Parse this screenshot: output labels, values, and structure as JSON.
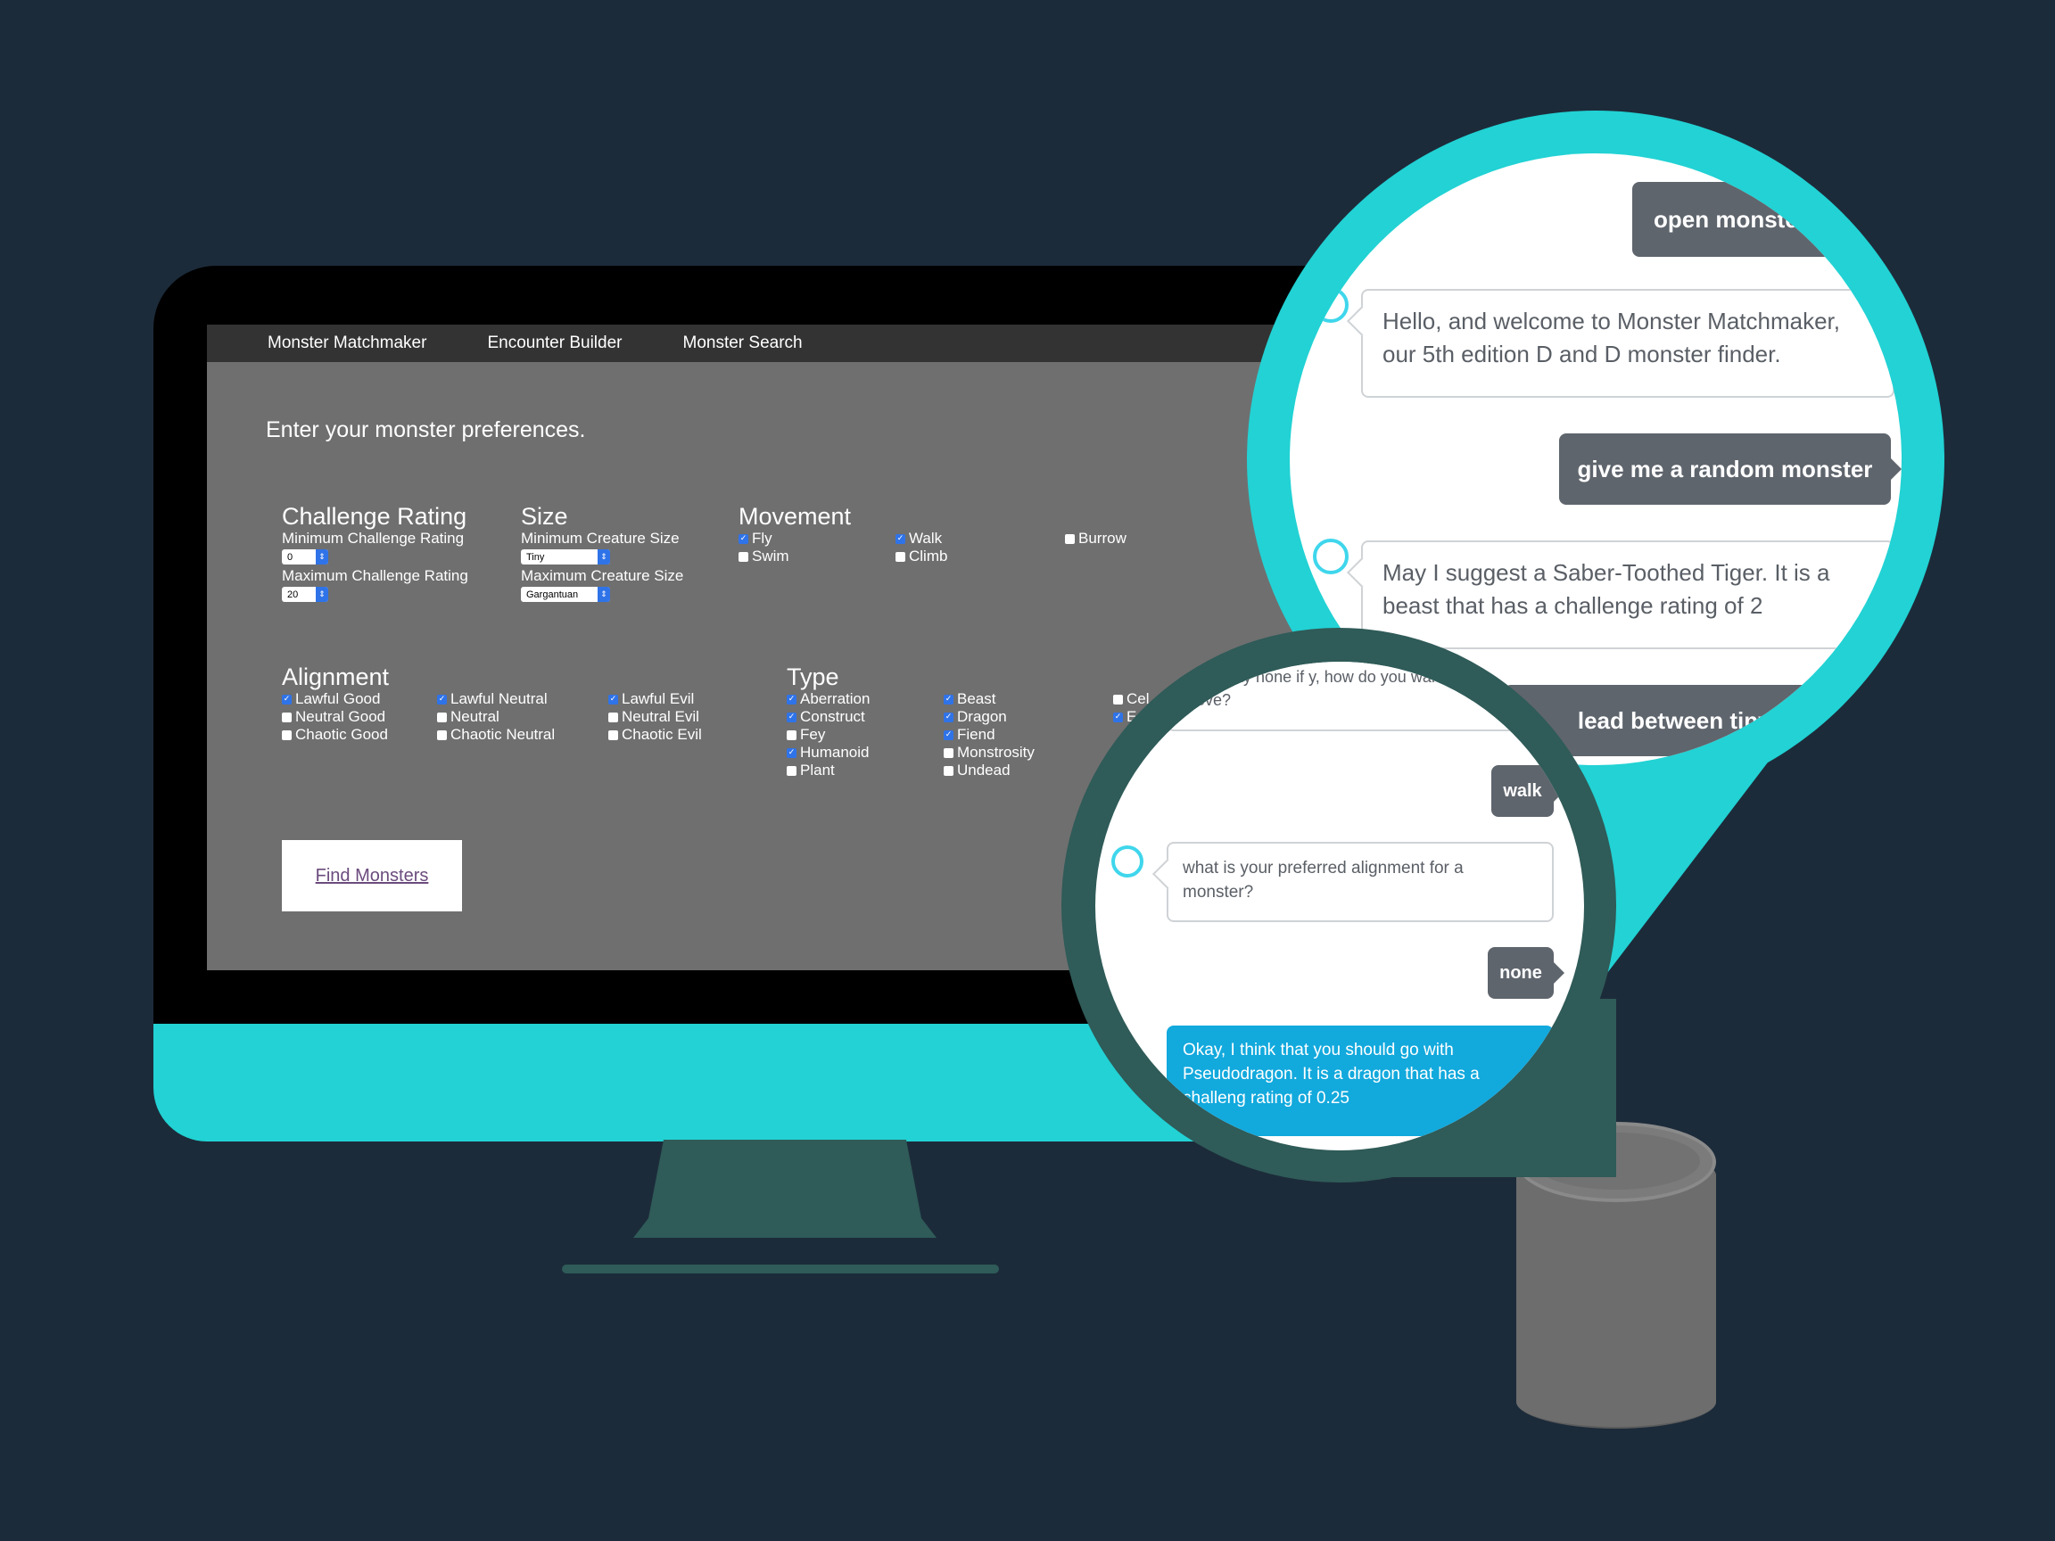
{
  "nav": {
    "items": [
      "Monster Matchmaker",
      "Encounter Builder",
      "Monster Search"
    ]
  },
  "page": {
    "heading": "Enter your monster preferences.",
    "find_button": "Find Monsters"
  },
  "challenge": {
    "title": "Challenge Rating",
    "min_label": "Minimum Challenge Rating",
    "min_value": "0",
    "max_label": "Maximum Challenge Rating",
    "max_value": "20"
  },
  "size": {
    "title": "Size",
    "min_label": "Minimum Creature Size",
    "min_value": "Tiny",
    "max_label": "Maximum Creature Size",
    "max_value": "Gargantuan"
  },
  "movement": {
    "title": "Movement",
    "options": [
      {
        "label": "Fly",
        "checked": true
      },
      {
        "label": "Swim",
        "checked": false
      },
      {
        "label": "Walk",
        "checked": true
      },
      {
        "label": "Climb",
        "checked": false
      },
      {
        "label": "Burrow",
        "checked": false
      }
    ]
  },
  "alignment": {
    "title": "Alignment",
    "options": [
      {
        "label": "Lawful Good",
        "checked": true
      },
      {
        "label": "Neutral Good",
        "checked": false
      },
      {
        "label": "Chaotic Good",
        "checked": false
      },
      {
        "label": "Lawful Neutral",
        "checked": true
      },
      {
        "label": "Neutral",
        "checked": false
      },
      {
        "label": "Chaotic Neutral",
        "checked": false
      },
      {
        "label": "Lawful Evil",
        "checked": true
      },
      {
        "label": "Neutral Evil",
        "checked": false
      },
      {
        "label": "Chaotic Evil",
        "checked": false
      }
    ]
  },
  "type": {
    "title": "Type",
    "options": [
      {
        "label": "Aberration",
        "checked": true
      },
      {
        "label": "Construct",
        "checked": true
      },
      {
        "label": "Fey",
        "checked": false
      },
      {
        "label": "Humanoid",
        "checked": true
      },
      {
        "label": "Plant",
        "checked": false
      },
      {
        "label": "Beast",
        "checked": true
      },
      {
        "label": "Dragon",
        "checked": true
      },
      {
        "label": "Fiend",
        "checked": true
      },
      {
        "label": "Monstrosity",
        "checked": false
      },
      {
        "label": "Undead",
        "checked": false
      },
      {
        "label": "Cel",
        "checked": false
      },
      {
        "label": "E",
        "checked": true
      }
    ]
  },
  "chat_big": {
    "user_1": "open monste",
    "bot_1": "Hello, and welcome to Monster Matchmaker, our 5th edition D and D monster finder.",
    "user_2": "give me a random monster",
    "bot_2": "May I suggest a Saber-Toothed Tiger. It is a beast that has a challenge rating of 2",
    "user_3": "lead between tiny an"
  },
  "chat_small": {
    "bot_1": "u can say none if y, how do you want your monst move?",
    "user_1": "walk",
    "bot_2": "what is your preferred alignment for a monster?",
    "user_2": "none",
    "bot_3": "Okay, I think that you should go with Pseudodragon. It is a dragon that has a challeng rating of 0.25"
  },
  "colors": {
    "background": "#1c2b3a",
    "accent_cyan": "#22d2d4",
    "accent_teal": "#2f5b58",
    "checkbox_blue": "#2f73e8",
    "alexa_blue": "#12a9dd"
  }
}
